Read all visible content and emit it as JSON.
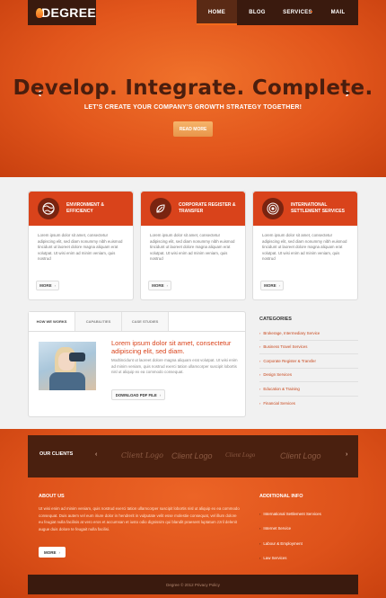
{
  "brand": {
    "name": "DEGREE"
  },
  "nav": {
    "items": [
      "HOME",
      "BLOG",
      "SERVICES",
      "MAIL"
    ]
  },
  "hero": {
    "title": "Develop. Integrate. Complete.",
    "subtitle": "LET'S CREATE YOUR COMPANY'S GROWTH STRATEGY TOGETHER!",
    "button": "READ MORE",
    "prev_icon": "chevron-left-icon",
    "next_icon": "chevron-right-icon"
  },
  "cards": [
    {
      "title_1": "ENVIRONMENT &",
      "title_2": "EFFICIENCY",
      "icon": "globe-icon",
      "text": "Lorem ipsum dolor sit amet, consectetur adipiscing elit, sed diam nonummy nibh euismod tincidunt ut laoreet dolore magna aliquam erat volutpat. Ut wisi enim ad minim veniam, quis nostrud",
      "button": "MORE"
    },
    {
      "title_1": "CORPORATE REGISTER &",
      "title_2": "TRANSFER",
      "icon": "leaf-icon",
      "text": "Lorem ipsum dolor sit amet, consectetur adipiscing elit, sed diam nonummy nibh euismod tincidunt ut laoreet dolore magna aliquam erat volutpat. Ut wisi enim ad minim veniam, quis nostrud",
      "button": "MORE"
    },
    {
      "title_1": "INTERNATIONAL",
      "title_2": "SETTLEMENT SERVICES",
      "icon": "target-icon",
      "text": "Lorem ipsum dolor sit amet, consectetur adipiscing elit, sed diam nonummy nibh euismod tincidunt ut laoreet dolore magna aliquam erat volutpat. Ut wisi enim ad minim veniam, quis nostrud",
      "button": "MORE"
    }
  ],
  "tabs": {
    "labels": [
      "HOW WE WORKS",
      "CAPABILITIES",
      "CASE STUDIES"
    ],
    "headline": "Lorem ipsum dolor sit amet, consectetur adipiscing elit, sed diam.",
    "text": "Modtincidunt ut laoreet dolore magna aliquam erat volutpat. Ut wisi enim ad minim veniam, quis nostrud exerci tation ullamcorper suscipit lobortis nisl ut aliquip ex ea commodo consequat.",
    "button": "DOWNLOAD PDF FILE"
  },
  "categories": {
    "title": "CATEGORIES",
    "items": [
      "Brokerage, Intermediary Service",
      "Business Travel Services",
      "Corporate Register & Transfer",
      "Design Services",
      "Education & Training",
      "Financial Services"
    ]
  },
  "clients": {
    "title": "OUR CLIENTS",
    "logos": [
      "Client Logo",
      "Client Logo",
      "Client Logo",
      "Client Logo"
    ]
  },
  "about": {
    "title": "ABOUT US",
    "text": "Ut wisi enim ad minim veniam, quis nostrud exerci tation ullamcorper suscipit lobortis nisl ut aliquip ex ea commodo consequat. Duis autem vel eum iriure dolor in hendrerit in vulputate velit esse molestie consequat, vel illum dolore eu feugiat nulla facilisis at vero eros et accumsan et iusto odio dignissim qui blandit praesent luptatum zzril delenit augue duis dolore te feugait nulla facilisi.",
    "button": "MORE"
  },
  "info": {
    "title": "ADDITIONAL INFO",
    "items": [
      "International Settlement Services",
      "Internet Service",
      "Labour & Employment",
      "Law Services"
    ]
  },
  "copyright": "Degree © 2012 Privacy Policy"
}
